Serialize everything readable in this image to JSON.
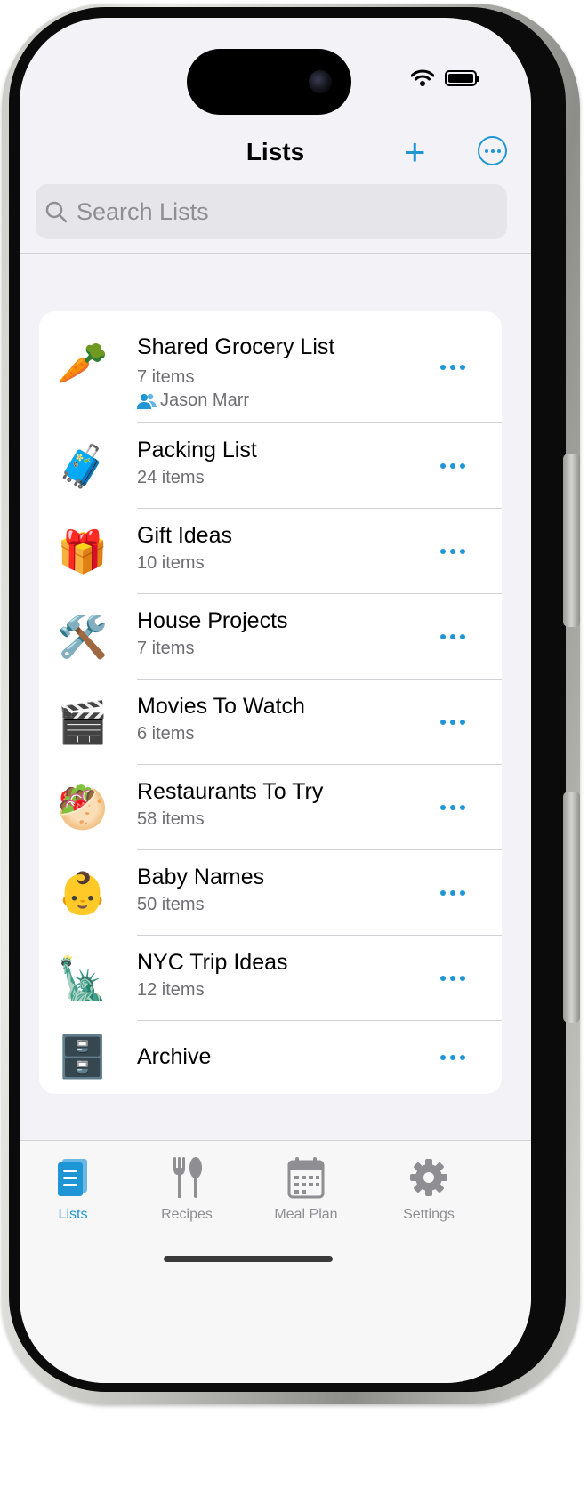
{
  "status_bar": {
    "icons": [
      "wifi-icon",
      "battery-icon"
    ]
  },
  "nav": {
    "title": "Lists",
    "add_label": "+"
  },
  "search": {
    "placeholder": "Search Lists"
  },
  "lists": [
    {
      "emoji": "🥕",
      "icon": "carrot-icon",
      "title": "Shared Grocery List",
      "subtitle": "7 items",
      "shared_with": "Jason Marr"
    },
    {
      "emoji": "🧳",
      "icon": "luggage-icon",
      "title": "Packing List",
      "subtitle": "24 items"
    },
    {
      "emoji": "🎁",
      "icon": "gift-icon",
      "title": "Gift Ideas",
      "subtitle": "10 items"
    },
    {
      "emoji": "🛠️",
      "icon": "tools-icon",
      "title": "House Projects",
      "subtitle": "7 items"
    },
    {
      "emoji": "🎬",
      "icon": "clapper-icon",
      "title": "Movies To Watch",
      "subtitle": "6 items"
    },
    {
      "emoji": "🥙",
      "icon": "pita-icon",
      "title": "Restaurants To Try",
      "subtitle": "58 items"
    },
    {
      "emoji": "👶",
      "icon": "baby-icon",
      "title": "Baby Names",
      "subtitle": "50 items"
    },
    {
      "emoji": "🗽",
      "icon": "statue-of-liberty-icon",
      "title": "NYC Trip Ideas",
      "subtitle": "12 items"
    },
    {
      "emoji": "🗄️",
      "icon": "file-cabinet-icon",
      "title": "Archive"
    }
  ],
  "tabs": [
    {
      "label": "Lists",
      "icon": "lists-icon",
      "active": true
    },
    {
      "label": "Recipes",
      "icon": "fork-spoon-icon",
      "active": false
    },
    {
      "label": "Meal Plan",
      "icon": "calendar-icon",
      "active": false
    },
    {
      "label": "Settings",
      "icon": "gear-icon",
      "active": false
    }
  ],
  "colors": {
    "accent": "#1e96d6",
    "background": "#f2f2f7",
    "secondary_text": "#6e6e73"
  }
}
